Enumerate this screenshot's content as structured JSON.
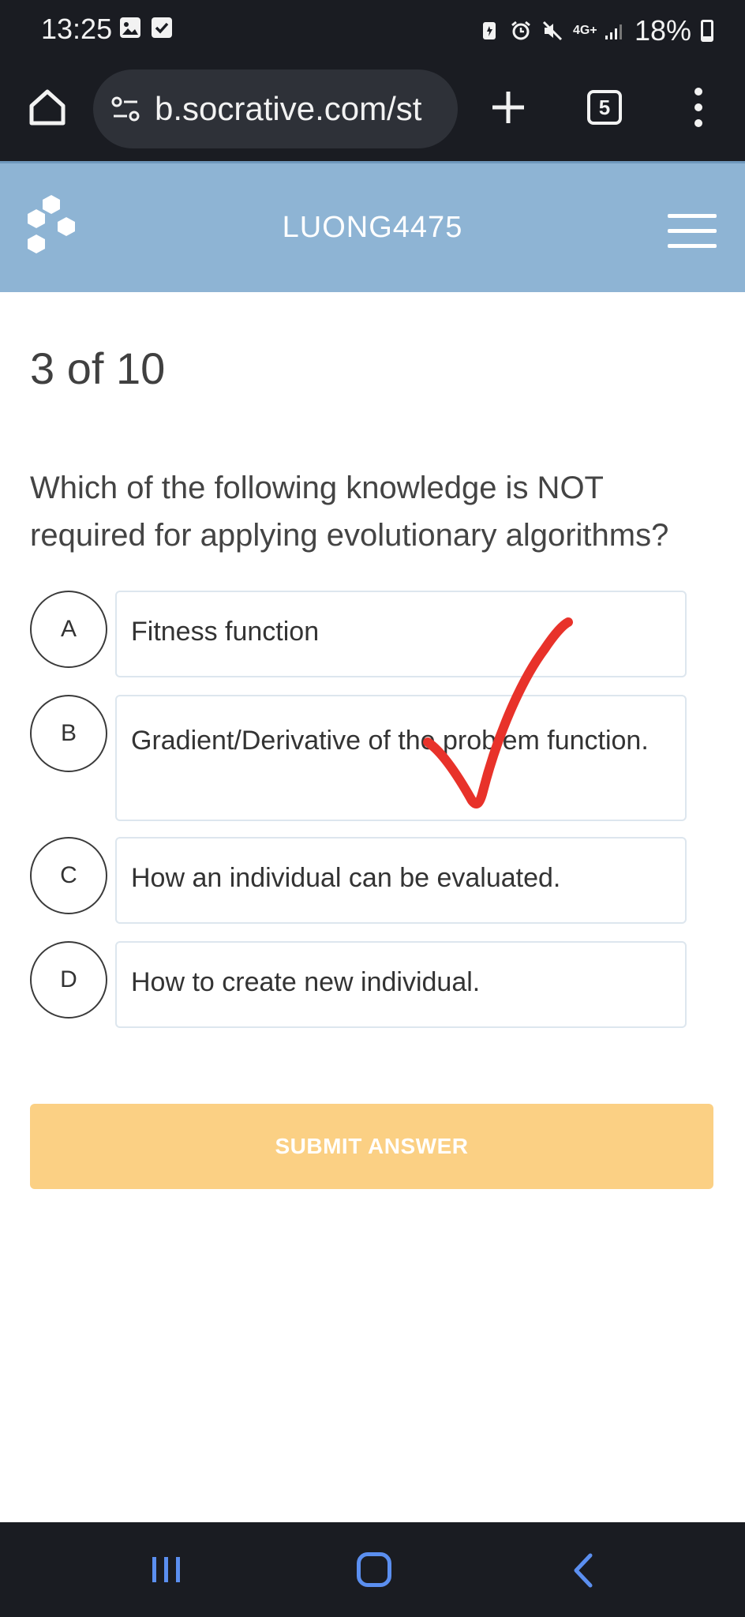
{
  "status_bar": {
    "time": "13:25",
    "network": "4G+",
    "battery": "18%",
    "battery_level": 0.18
  },
  "browser": {
    "url": "b.socrative.com/st",
    "tab_count": "5"
  },
  "header": {
    "room_name": "LUONG4475"
  },
  "quiz": {
    "progress": "3 of 10",
    "question": "Which of the following knowledge is NOT required for applying evolutionary algorithms?",
    "options": [
      {
        "letter": "A",
        "text": "Fitness function"
      },
      {
        "letter": "B",
        "text": "Gradient/Derivative of the problem function."
      },
      {
        "letter": "C",
        "text": "How an individual can be evaluated."
      },
      {
        "letter": "D",
        "text": "How to create new individual."
      }
    ],
    "submit_label": "SUBMIT ANSWER"
  },
  "colors": {
    "header_bg": "#8eb4d4",
    "submit_bg": "#fbd084",
    "annotation": "#e8322a"
  },
  "icons": {
    "home": "home-icon",
    "site_settings": "tune-icon",
    "new_tab": "plus-icon",
    "tabs": "tabs-icon",
    "menu": "more-vert-icon",
    "logo": "socrative-logo",
    "hamburger": "hamburger-icon"
  }
}
